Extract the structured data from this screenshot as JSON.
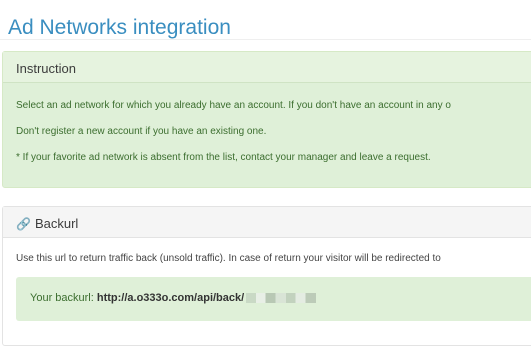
{
  "header": {
    "title": "Ad Networks integration"
  },
  "instruction": {
    "title": "Instruction",
    "lines": [
      "Select an ad network for which you already have an account. If you don't have an account in any o",
      "Don't register a new account if you have an existing one.",
      "* If your favorite ad network is absent from the list, contact your manager and leave a request."
    ]
  },
  "backurl": {
    "title": "Backurl",
    "icon": "link-icon",
    "description": "Use this url to return traffic back (unsold traffic). In case of return your visitor will be redirected to",
    "label": "Your backurl:",
    "url": "http://a.o333o.com/api/back/"
  },
  "colors": {
    "title": "#3a8ec0",
    "panel_green": "#dff0d8",
    "panel_border": "#d6e9c6"
  }
}
